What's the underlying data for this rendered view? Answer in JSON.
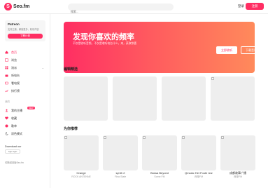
{
  "header": {
    "logo_mark": "S",
    "logo_text": "Seo.fm",
    "search_placeholder": "搜索...",
    "login_label": "登录",
    "register_label": "注册"
  },
  "sidebar": {
    "promo": {
      "title": "Patreon",
      "desc": "支持主播，解锁更多，精彩内容",
      "button": "了解计划"
    },
    "nav": [
      {
        "label": "首页",
        "icon": "home-icon"
      },
      {
        "label": "浏览",
        "icon": "browse-icon"
      },
      {
        "label": "流派",
        "icon": "genre-icon"
      },
      {
        "label": "听电台",
        "icon": "radio-icon"
      },
      {
        "label": "看电视",
        "icon": "tv-icon"
      },
      {
        "label": "排行榜",
        "icon": "chart-icon"
      }
    ],
    "my_section_label": "我的",
    "my_items": [
      {
        "label": "我的主播",
        "icon": "user-icon"
      },
      {
        "label": "收藏",
        "icon": "heart-icon"
      },
      {
        "label": "歌单",
        "icon": "playlist-icon"
      },
      {
        "label": "深色模式",
        "icon": "moon-icon"
      }
    ],
    "new_badge": "NEW",
    "download_label": "Download our",
    "download_button": "App login",
    "old_version": "切换回旧版Seo.fm"
  },
  "main": {
    "banner": {
      "title": "发现你喜欢的频率",
      "subtitle": "不仅是收听音频，不仅是收听电台什么，来，获取惊喜",
      "btn_primary": "立即收听",
      "btn_secondary": "下载音乐"
    },
    "featured_title": "编辑精选",
    "recommend_title": "为你推荐",
    "recommendations": [
      {
        "title": "Grange",
        "sub": "ROCK ANTENNE"
      },
      {
        "title": "synth 2",
        "sub": "Flow State"
      },
      {
        "title": "Bossa Beyond",
        "sub": "Some FM"
      },
      {
        "title": "Qmusic Het Foute Uur",
        "sub": "西单FM"
      },
      {
        "title": "成都故事广播",
        "sub": "西单FM"
      }
    ]
  },
  "colors": {
    "accent": "#ff2e63"
  }
}
